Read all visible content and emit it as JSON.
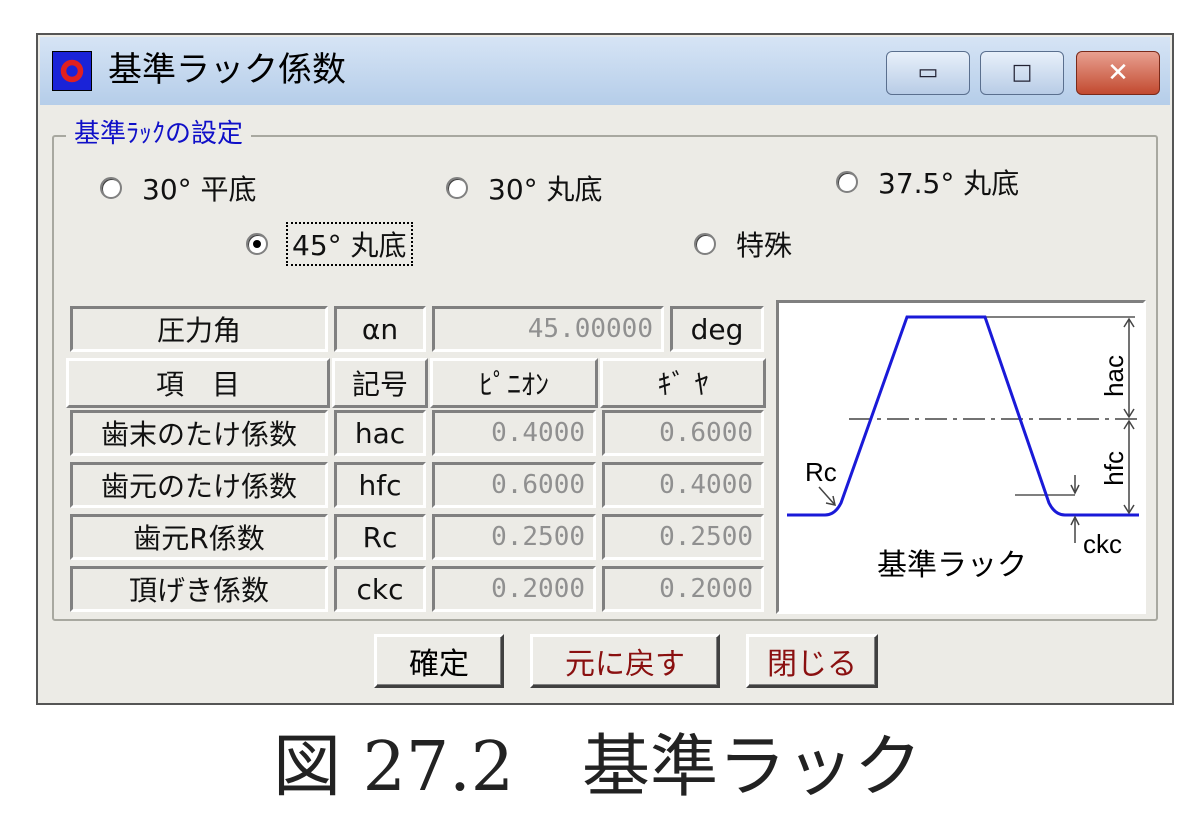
{
  "window": {
    "title": "基準ラック係数",
    "controls": {
      "minimize": "▭",
      "maximize": "□",
      "close": "✕"
    }
  },
  "group": {
    "legend": "基準ﾗｯｸの設定",
    "options": [
      {
        "label": "30° 平底",
        "selected": false
      },
      {
        "label": "30° 丸底",
        "selected": false
      },
      {
        "label": "37.5° 丸底",
        "selected": false
      },
      {
        "label": "45° 丸底",
        "selected": true
      },
      {
        "label": "特殊",
        "selected": false
      }
    ]
  },
  "pressure": {
    "label": "圧力角",
    "symbol": "αn",
    "value": "45.00000",
    "unit": "deg"
  },
  "table": {
    "headers": [
      "項　目",
      "記号",
      "ﾋﾟﾆｵﾝ",
      "ｷﾞ ﾔ"
    ],
    "rows": [
      {
        "item": "歯末のたけ係数",
        "symbol": "hac",
        "pinion": "0.4000",
        "gear": "0.6000"
      },
      {
        "item": "歯元のたけ係数",
        "symbol": "hfc",
        "pinion": "0.6000",
        "gear": "0.4000"
      },
      {
        "item": "歯元R係数",
        "symbol": "Rc",
        "pinion": "0.2500",
        "gear": "0.2500"
      },
      {
        "item": "頂げき係数",
        "symbol": "ckc",
        "pinion": "0.2000",
        "gear": "0.2000"
      }
    ]
  },
  "diagram": {
    "title": "基準ラック",
    "labels": {
      "hac": "hac",
      "hfc": "hfc",
      "rc": "Rc",
      "ckc": "ckc"
    },
    "profile_color": "#1a1ad8"
  },
  "buttons": {
    "confirm": "確定",
    "reset": "元に戻す",
    "close": "閉じる"
  },
  "caption": "図 27.2　基準ラック"
}
